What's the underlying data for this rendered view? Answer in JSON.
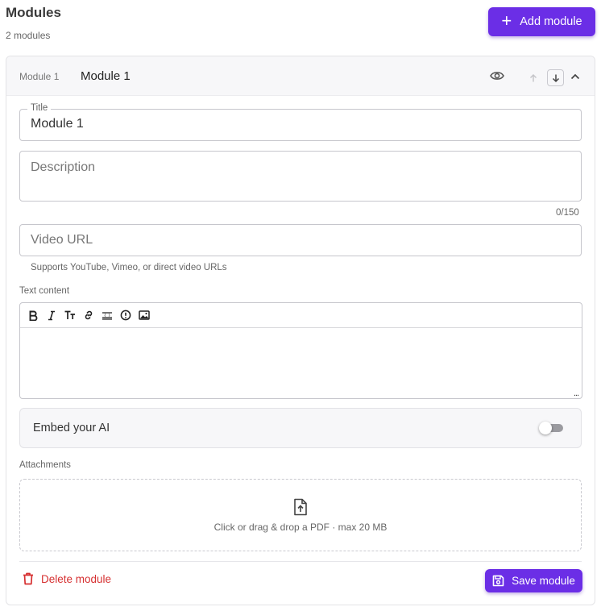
{
  "header": {
    "title": "Modules",
    "count": "2 modules",
    "add_label": "Add module"
  },
  "module": {
    "index_label": "Module 1",
    "name": "Module 1",
    "title_legend": "Title",
    "title_value": "Module 1",
    "description_placeholder": "Description",
    "description_count": "0/150",
    "video_placeholder": "Video URL",
    "video_help": "Supports YouTube, Vimeo, or direct video URLs",
    "text_content_label": "Text content",
    "toolbar": [
      "bold-icon",
      "italic-icon",
      "text-size-icon",
      "link-icon",
      "code-icon",
      "alert-icon",
      "image-icon"
    ],
    "embed_label": "Embed your AI",
    "embed_enabled": false,
    "attachments_label": "Attachments",
    "drop_text": "Click or drag & drop a PDF · max 20 MB",
    "delete_label": "Delete module",
    "save_label": "Save module"
  },
  "colors": {
    "accent": "#6b2ee6",
    "danger": "#d63031"
  }
}
